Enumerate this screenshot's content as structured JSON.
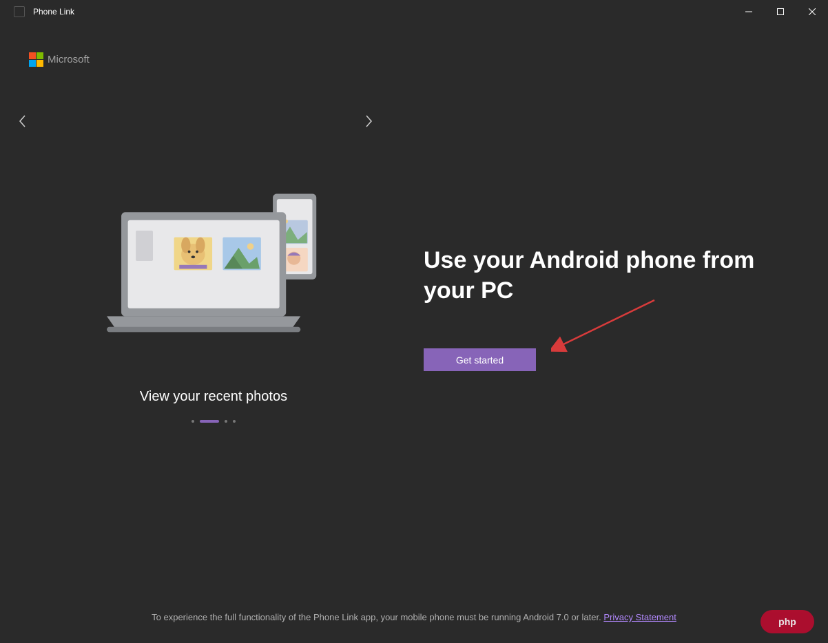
{
  "titlebar": {
    "title": "Phone Link"
  },
  "logo": {
    "text": "Microsoft"
  },
  "carousel": {
    "caption": "View your recent photos",
    "active_index": 1,
    "total_dots": 4
  },
  "main": {
    "headline": "Use your Android phone from your PC",
    "cta_label": "Get started"
  },
  "footer": {
    "text": "To experience the full functionality of the Phone Link app, your mobile phone must be running Android 7.0 or later. ",
    "link_label": "Privacy Statement"
  },
  "watermark": {
    "label": "php"
  }
}
